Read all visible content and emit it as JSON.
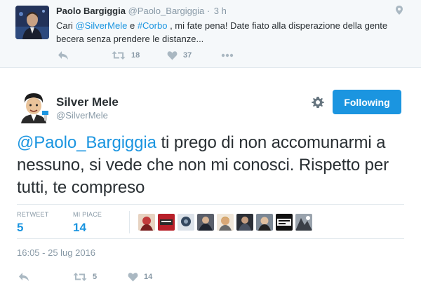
{
  "parent_tweet": {
    "name": "Paolo Bargiggia",
    "handle": "@Paolo_Bargiggia",
    "separator": "·",
    "time": "3 h",
    "text": {
      "part1": "Cari ",
      "mention1": "@SilverMele",
      "part2": " e ",
      "hashtag": "#Corbo",
      "part3": " , mi fate pena! Date fiato alla disperazione della gente becera senza prendere le distanze..."
    },
    "retweets": "18",
    "likes": "37",
    "icons": [
      "reply-icon",
      "retweet-icon",
      "like-icon",
      "more-icon",
      "chevron-down-icon"
    ]
  },
  "main_tweet": {
    "name": "Silver Mele",
    "handle": "@SilverMele",
    "follow_label": "Following",
    "text": {
      "mention": "@Paolo_Bargiggia",
      "body": " ti prego di non accomunarmi a nessuno, si vede che non mi conosci. Rispetto per tutti, te compreso"
    },
    "stats": {
      "retweet_label": "RETWEET",
      "retweet_value": "5",
      "like_label": "MI PIACE",
      "like_value": "14"
    },
    "liker_avatar_count": 9,
    "date": "16:05 - 25 lug 2016",
    "retweets": "5",
    "likes": "14",
    "icons": [
      "reply-icon",
      "retweet-icon",
      "like-icon",
      "gear-icon"
    ]
  },
  "colors": {
    "link_blue": "#1b95e0",
    "gray_text": "#8899a6",
    "dark_text": "#292f33",
    "divider": "#e1e8ed",
    "parent_bg": "#f5f8fa"
  }
}
